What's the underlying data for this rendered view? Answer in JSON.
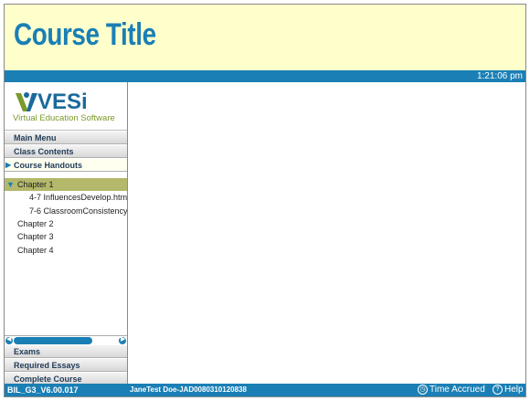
{
  "header": {
    "course_title": "Course Title"
  },
  "timebar": {
    "clock": "1:21:06 pm"
  },
  "logo": {
    "name": "VESi",
    "tagline": "Virtual Education Software"
  },
  "menu": {
    "main_menu": "Main Menu",
    "class_contents": "Class Contents",
    "course_handouts": "Course Handouts"
  },
  "tree": {
    "chapters": [
      "Chapter 1",
      "Chapter 2",
      "Chapter 3",
      "Chapter 4"
    ],
    "files": [
      "4-7 InfluencesDevelop.htm",
      "7-6 ClassroomConsistency"
    ]
  },
  "bottom_menu": {
    "exams": "Exams",
    "required_essays": "Required Essays",
    "complete_course": "Complete Course"
  },
  "footer": {
    "version": "BIL_G3_V6.00.017",
    "user": "JaneTest Doe-JAD0080310120838",
    "time_accrued": "Time Accrued",
    "help": "Help"
  },
  "colors": {
    "accent": "#1a7fb5",
    "header_bg": "#ffffcc",
    "selected": "#b3b86a"
  }
}
